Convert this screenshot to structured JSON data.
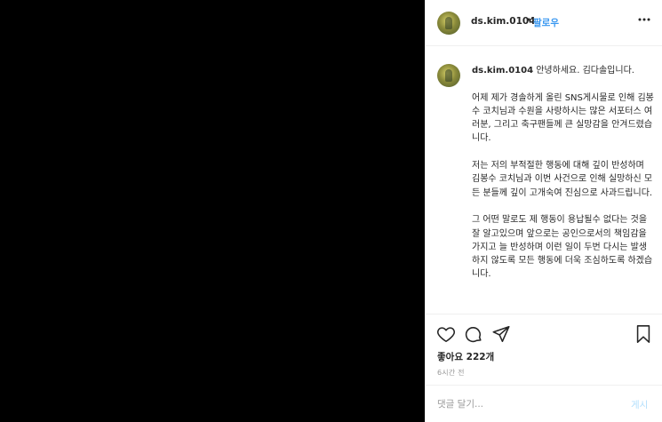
{
  "post": {
    "username": "ds.kim.0104",
    "follow_separator": "•",
    "follow_label": "팔로우",
    "more_label": "•••",
    "caption_user": "ds.kim.0104",
    "caption_text": " 안녕하세요. 김다솔입니다.\n\n어제 제가 경솔하게 올린 SNS게시물로 인해 김봉수 코치님과 수원을 사랑하시는 많은 서포터스 여러분, 그리고 축구팬들께 큰 실망감을 안겨드렸습니다.\n\n저는 저의 부적절한 행동에 대해 깊이 반성하며 김봉수 코치님과 이번 사건으로 인해 실망하신 모든 분들께 깊이 고개숙여 진심으로 사과드립니다.\n\n그 어떤 말로도 제 행동이 용납될수 없다는 것을 잘 알고있으며 앞으로는 공인으로서의 책임감을 가지고 늘 반성하며 이런 일이 두번 다시는 발생하지 않도록 모든 행동에 더욱 조심하도록 하겠습니다.",
    "likes": "좋아요 222개",
    "time_ago": "6시간 전",
    "comment_placeholder": "댓글 달기...",
    "post_label": "게시"
  },
  "icons": {
    "like": "heart-icon",
    "comment": "comment-bubble-icon",
    "share": "paper-plane-icon",
    "save": "bookmark-icon",
    "more": "more-options-icon"
  },
  "colors": {
    "link_blue": "#3897f0",
    "post_button_disabled": "#b2dffc",
    "muted_text": "#999999",
    "border": "#efefef"
  }
}
